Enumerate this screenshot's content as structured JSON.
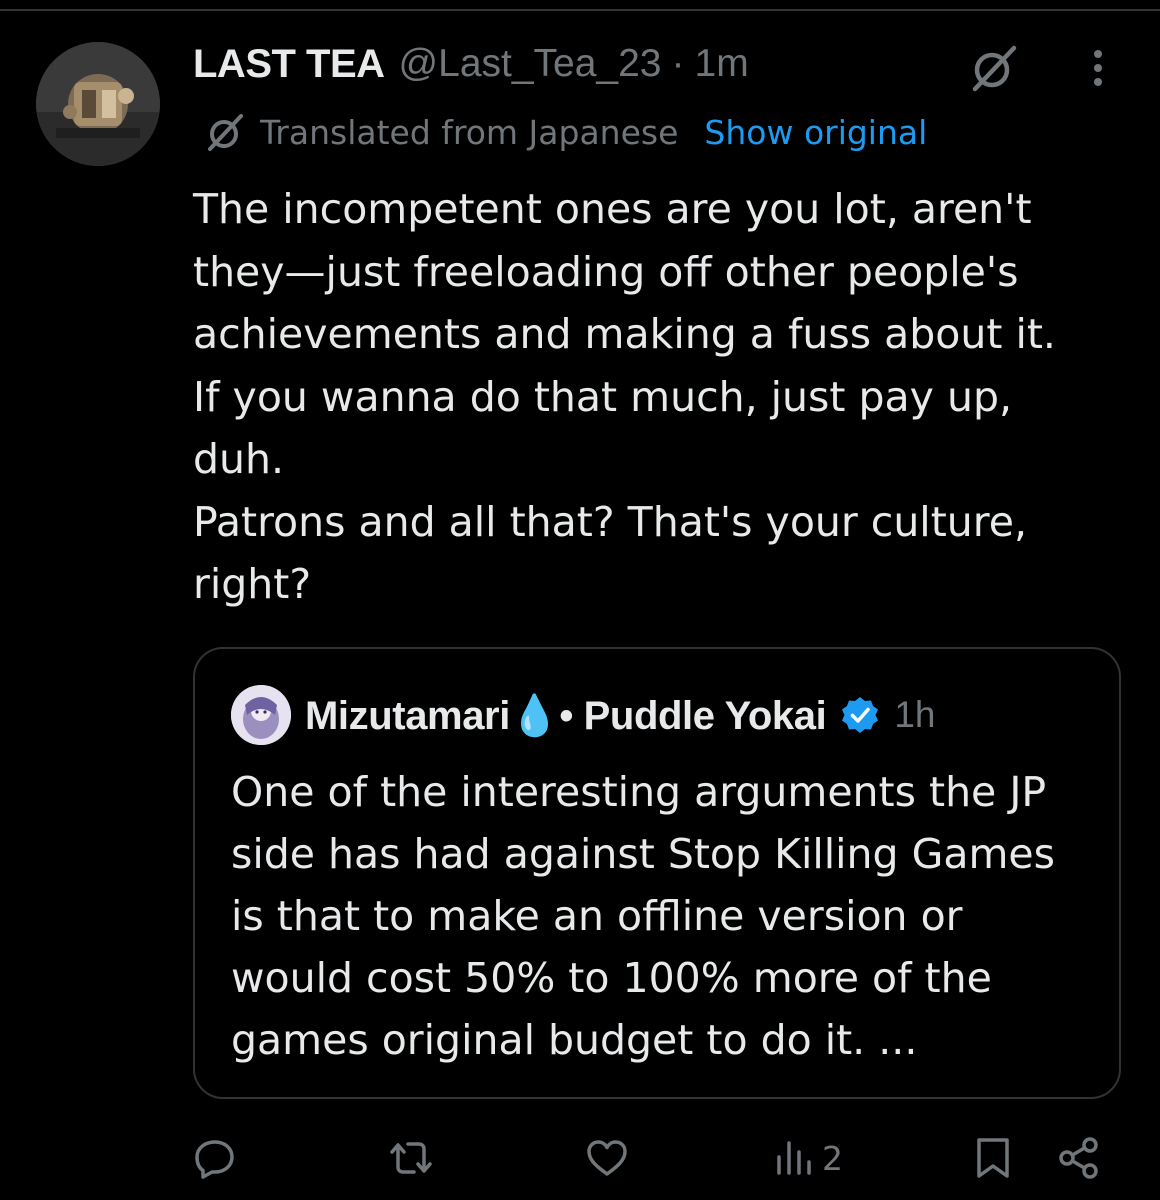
{
  "post": {
    "display_name": "LAST TEA",
    "handle": "@Last_Tea_23",
    "separator": "·",
    "time": "1m",
    "translated_label": "Translated from Japanese",
    "show_original": "Show original",
    "body_lines": [
      "The incompetent ones are you lot, aren't",
      "they—just freeloading off other people's",
      "achievements and making a fuss about it.",
      "If you wanna do that much, just pay up,",
      "duh.",
      "Patrons and all that? That's your culture,",
      "right?"
    ]
  },
  "quote": {
    "display_name": "Mizutamari💧• Puddle Yokai",
    "separator": "·",
    "time": "1h",
    "verified": true,
    "body_lines": [
      "One of the interesting arguments the JP",
      "side has had against Stop Killing Games",
      "is that to make an offline version or",
      "would cost 50% to 100% more of the",
      "games original budget to do it. ..."
    ]
  },
  "actions": {
    "views_count": "2"
  },
  "icons": {
    "grok": "grok-icon",
    "more": "more-icon",
    "translate": "translate-icon",
    "verified": "verified-badge-icon",
    "reply": "reply-icon",
    "repost": "repost-icon",
    "like": "like-icon",
    "views": "views-icon",
    "bookmark": "bookmark-icon",
    "share": "share-icon"
  },
  "colors": {
    "background": "#000000",
    "text_primary": "#e7e9ea",
    "text_secondary": "#71767b",
    "link": "#1d9bf0",
    "border": "#2f3336"
  }
}
